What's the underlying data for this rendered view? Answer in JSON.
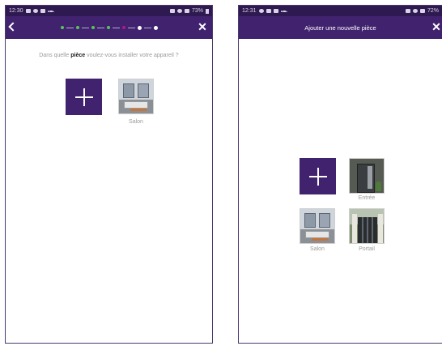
{
  "left_screen": {
    "status": {
      "time": "12:30",
      "battery": "73%"
    },
    "question": {
      "before": "Dans quelle ",
      "bold": "pièce",
      "after": " voulez-vous installer votre appareil ?"
    },
    "rooms": [
      {
        "label": "Salon",
        "icon": "salon-photo"
      }
    ],
    "add_icon": "plus-icon",
    "stepper": {
      "total": 7,
      "completed": 4,
      "current": 5
    }
  },
  "right_screen": {
    "status": {
      "time": "12:31",
      "battery": "72%"
    },
    "title": "Ajouter une nouvelle pièce",
    "rooms": [
      {
        "label": "Entrée",
        "icon": "entree-photo"
      },
      {
        "label": "Salon",
        "icon": "salon-photo"
      },
      {
        "label": "Portail",
        "icon": "portail-photo"
      }
    ],
    "add_icon": "plus-icon"
  },
  "colors": {
    "appbar": "#40226e",
    "statusbar": "#2e1a50",
    "step_done": "#5bc15f",
    "step_current": "#b0178d"
  }
}
